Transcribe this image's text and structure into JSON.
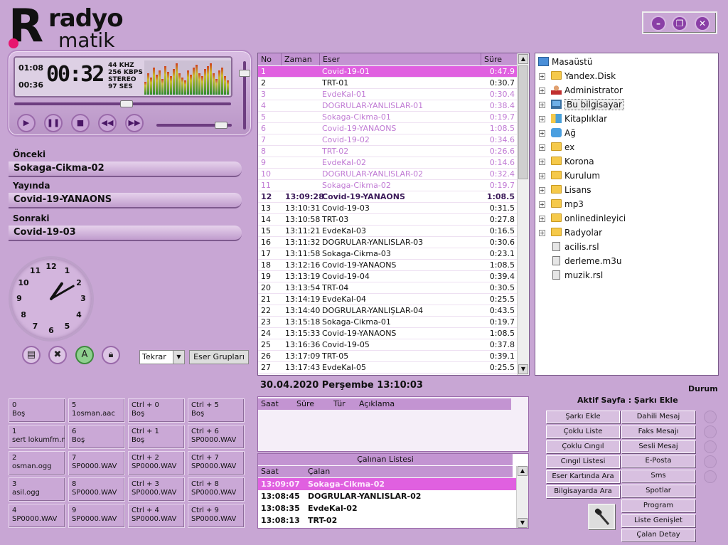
{
  "app": {
    "logo_top": "radyo",
    "logo_bottom": "matik",
    "window_buttons": [
      "minimize",
      "restore",
      "close"
    ]
  },
  "player": {
    "elapsed": "01:08",
    "remaining": "00:36",
    "countdown": "00:32",
    "info": [
      "44 KHZ",
      "256 KBPS",
      "STEREO",
      "97 SES"
    ],
    "progress": 0.52,
    "volume": 0.86,
    "controls": [
      "play",
      "pause",
      "stop",
      "previous",
      "next"
    ]
  },
  "queue": {
    "previous_label": "Önceki",
    "previous": "Sokaga-Cikma-02",
    "onair_label": "Yayında",
    "onair": "Covid-19-YANAONS",
    "next_label": "Sonraki",
    "next": "Covid-19-03"
  },
  "clock": {
    "numbers": [
      "12",
      "1",
      "2",
      "3",
      "4",
      "5",
      "6",
      "7",
      "8",
      "9",
      "10",
      "11"
    ],
    "hour": 1,
    "minute": 10
  },
  "tools": {
    "repeat_select": "Tekrar",
    "groups_button": "Eser Grupları"
  },
  "hotkeys": [
    {
      "key": "0",
      "value": "Boş"
    },
    {
      "key": "5",
      "value": "1osman.aac"
    },
    {
      "key": "Ctrl + 0",
      "value": "Boş"
    },
    {
      "key": "Ctrl + 5",
      "value": "Boş"
    },
    {
      "key": "1",
      "value": "sert lokumfm.mp"
    },
    {
      "key": "6",
      "value": "Boş"
    },
    {
      "key": "Ctrl + 1",
      "value": "Boş"
    },
    {
      "key": "Ctrl + 6",
      "value": "SP0000.WAV"
    },
    {
      "key": "2",
      "value": "osman.ogg"
    },
    {
      "key": "7",
      "value": "SP0000.WAV"
    },
    {
      "key": "Ctrl + 2",
      "value": "SP0000.WAV"
    },
    {
      "key": "Ctrl + 7",
      "value": "SP0000.WAV"
    },
    {
      "key": "3",
      "value": "asil.ogg"
    },
    {
      "key": "8",
      "value": "SP0000.WAV"
    },
    {
      "key": "Ctrl + 3",
      "value": "SP0000.WAV"
    },
    {
      "key": "Ctrl + 8",
      "value": "SP0000.WAV"
    },
    {
      "key": "4",
      "value": "SP0000.WAV"
    },
    {
      "key": "9",
      "value": "SP0000.WAV"
    },
    {
      "key": "Ctrl + 4",
      "value": "SP0000.WAV"
    },
    {
      "key": "Ctrl + 9",
      "value": "SP0000.WAV"
    }
  ],
  "playlist": {
    "columns": [
      "No",
      "Zaman",
      "Eser",
      "Süre"
    ],
    "rows": [
      {
        "no": "1",
        "time": "",
        "title": "Covid-19-01",
        "dur": "0:47.9",
        "state": "current"
      },
      {
        "no": "2",
        "time": "",
        "title": "TRT-01",
        "dur": "0:30.7",
        "state": "normal"
      },
      {
        "no": "3",
        "time": "",
        "title": "EvdeKal-01",
        "dur": "0:30.4",
        "state": "played"
      },
      {
        "no": "4",
        "time": "",
        "title": "DOGRULAR-YANLISLAR-01",
        "dur": "0:38.4",
        "state": "played"
      },
      {
        "no": "5",
        "time": "",
        "title": "Sokaga-Cikma-01",
        "dur": "0:19.7",
        "state": "played"
      },
      {
        "no": "6",
        "time": "",
        "title": "Covid-19-YANAONS",
        "dur": "1:08.5",
        "state": "played"
      },
      {
        "no": "7",
        "time": "",
        "title": "Covid-19-02",
        "dur": "0:34.6",
        "state": "played"
      },
      {
        "no": "8",
        "time": "",
        "title": "TRT-02",
        "dur": "0:26.6",
        "state": "played"
      },
      {
        "no": "9",
        "time": "",
        "title": "EvdeKal-02",
        "dur": "0:14.6",
        "state": "played"
      },
      {
        "no": "10",
        "time": "",
        "title": "DOGRULAR-YANLISLAR-02",
        "dur": "0:32.4",
        "state": "played"
      },
      {
        "no": "11",
        "time": "",
        "title": "Sokaga-Cikma-02",
        "dur": "0:19.7",
        "state": "played"
      },
      {
        "no": "12",
        "time": "13:09:28",
        "title": "Covid-19-YANAONS",
        "dur": "1:08.5",
        "state": "onair"
      },
      {
        "no": "13",
        "time": "13:10:31",
        "title": "Covid-19-03",
        "dur": "0:31.5",
        "state": "normal"
      },
      {
        "no": "14",
        "time": "13:10:58",
        "title": "TRT-03",
        "dur": "0:27.8",
        "state": "normal"
      },
      {
        "no": "15",
        "time": "13:11:21",
        "title": "EvdeKal-03",
        "dur": "0:16.5",
        "state": "normal"
      },
      {
        "no": "16",
        "time": "13:11:32",
        "title": "DOGRULAR-YANLISLAR-03",
        "dur": "0:30.6",
        "state": "normal"
      },
      {
        "no": "17",
        "time": "13:11:58",
        "title": "Sokaga-Cikma-03",
        "dur": "0:23.1",
        "state": "normal"
      },
      {
        "no": "18",
        "time": "13:12:16",
        "title": "Covid-19-YANAONS",
        "dur": "1:08.5",
        "state": "normal"
      },
      {
        "no": "19",
        "time": "13:13:19",
        "title": "Covid-19-04",
        "dur": "0:39.4",
        "state": "normal"
      },
      {
        "no": "20",
        "time": "13:13:54",
        "title": "TRT-04",
        "dur": "0:30.5",
        "state": "normal"
      },
      {
        "no": "21",
        "time": "13:14:19",
        "title": "EvdeKal-04",
        "dur": "0:25.5",
        "state": "normal"
      },
      {
        "no": "22",
        "time": "13:14:40",
        "title": "DOGRULAR-YANLIŞLAR-04",
        "dur": "0:43.5",
        "state": "normal"
      },
      {
        "no": "23",
        "time": "13:15:18",
        "title": "Sokaga-Cikma-01",
        "dur": "0:19.7",
        "state": "normal"
      },
      {
        "no": "24",
        "time": "13:15:33",
        "title": "Covid-19-YANAONS",
        "dur": "1:08.5",
        "state": "normal"
      },
      {
        "no": "25",
        "time": "13:16:36",
        "title": "Covid-19-05",
        "dur": "0:37.8",
        "state": "normal"
      },
      {
        "no": "26",
        "time": "13:17:09",
        "title": "TRT-05",
        "dur": "0:39.1",
        "state": "normal"
      },
      {
        "no": "27",
        "time": "13:17:43",
        "title": "EvdeKal-05",
        "dur": "0:25.5",
        "state": "normal"
      }
    ]
  },
  "tree": [
    {
      "label": "Masaüstü",
      "icon": "desktop",
      "level": 0,
      "expand": false
    },
    {
      "label": "Yandex.Disk",
      "icon": "folder",
      "level": 1,
      "expand": true
    },
    {
      "label": "Administrator",
      "icon": "user",
      "level": 1,
      "expand": true
    },
    {
      "label": "Bu bilgisayar",
      "icon": "computer",
      "level": 1,
      "expand": true,
      "selected": true
    },
    {
      "label": "Kitaplıklar",
      "icon": "library",
      "level": 1,
      "expand": true
    },
    {
      "label": "Ağ",
      "icon": "network",
      "level": 1,
      "expand": true
    },
    {
      "label": "ex",
      "icon": "folder",
      "level": 1,
      "expand": true
    },
    {
      "label": "Korona",
      "icon": "folder",
      "level": 1,
      "expand": true
    },
    {
      "label": "Kurulum",
      "icon": "folder",
      "level": 1,
      "expand": true
    },
    {
      "label": "Lisans",
      "icon": "folder",
      "level": 1,
      "expand": true
    },
    {
      "label": "mp3",
      "icon": "folder",
      "level": 1,
      "expand": true
    },
    {
      "label": "onlinedinleyici",
      "icon": "folder",
      "level": 1,
      "expand": true
    },
    {
      "label": "Radyolar",
      "icon": "folder",
      "level": 1,
      "expand": true
    },
    {
      "label": "acilis.rsl",
      "icon": "file",
      "level": 1,
      "expand": false
    },
    {
      "label": "derleme.m3u",
      "icon": "file",
      "level": 1,
      "expand": false
    },
    {
      "label": "muzik.rsl",
      "icon": "file",
      "level": 1,
      "expand": false
    }
  ],
  "datetime": "30.04.2020 Perşembe 13:10:03",
  "log": {
    "columns": [
      "Saat",
      "Süre",
      "Tür",
      "Açıklama"
    ]
  },
  "played_list": {
    "title": "Çalınan Listesi",
    "columns": [
      "Saat",
      "Çalan"
    ],
    "rows": [
      {
        "time": "13:09:07",
        "title": "Sokaga-Cikma-02",
        "highlight": true
      },
      {
        "time": "13:08:45",
        "title": "DOGRULAR-YANLISLAR-02",
        "highlight": false
      },
      {
        "time": "13:08:35",
        "title": "EvdeKal-02",
        "highlight": false
      },
      {
        "time": "13:08:13",
        "title": "TRT-02",
        "highlight": false
      }
    ]
  },
  "status": {
    "label": "Durum",
    "active_page": "Aktif Sayfa : Şarkı Ekle"
  },
  "actions_left": [
    "Şarkı Ekle",
    "Çoklu Liste",
    "Çoklu Cıngıl",
    "Cıngıl Listesi",
    "Eser Kartında Ara",
    "Bilgisayarda Ara"
  ],
  "actions_right": [
    "Dahili Mesaj",
    "Faks Mesajı",
    "Sesli Mesaj",
    "E-Posta",
    "Sms",
    "Spotlar",
    "Program",
    "Liste Genişlet",
    "Çalan Detay"
  ]
}
